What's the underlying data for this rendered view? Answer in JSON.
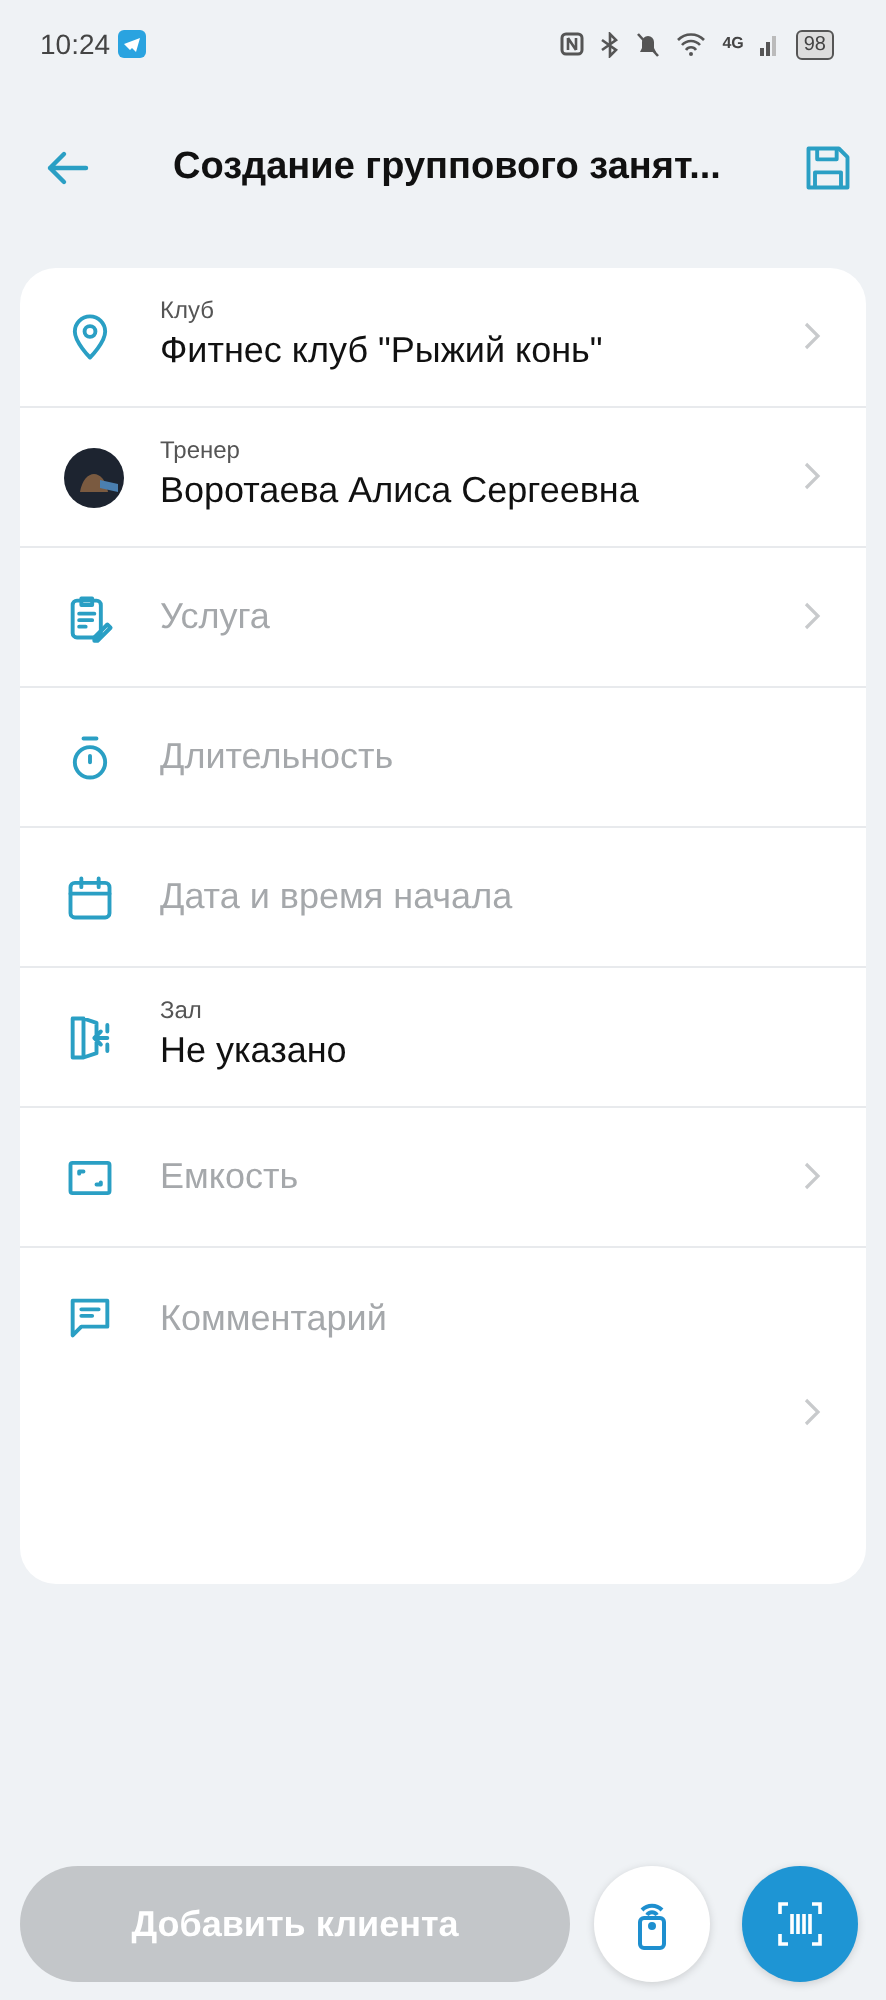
{
  "status_bar": {
    "time": "10:24",
    "network": "4G",
    "battery": "98"
  },
  "header": {
    "title": "Создание группового занят..."
  },
  "rows": [
    {
      "kind": "field",
      "label": "Клуб",
      "value": "Фитнес клуб \"Рыжий конь\"",
      "chevron": true
    },
    {
      "kind": "avatar",
      "label": "Тренер",
      "value": "Воротаева Алиса Сергеевна",
      "chevron": true
    },
    {
      "kind": "field",
      "placeholder": "Услуга",
      "chevron": true
    },
    {
      "kind": "field",
      "placeholder": "Длительность",
      "chevron": false
    },
    {
      "kind": "field",
      "placeholder": "Дата и время начала",
      "chevron": false
    },
    {
      "kind": "field",
      "label": "Зал",
      "value": "Не указано",
      "chevron": false
    },
    {
      "kind": "field",
      "placeholder": "Емкость",
      "chevron": true
    },
    {
      "kind": "comment",
      "placeholder": "Комментарий",
      "chevron": true
    }
  ],
  "add_client_button": {
    "label": "Добавить клиента",
    "disabled": true
  }
}
